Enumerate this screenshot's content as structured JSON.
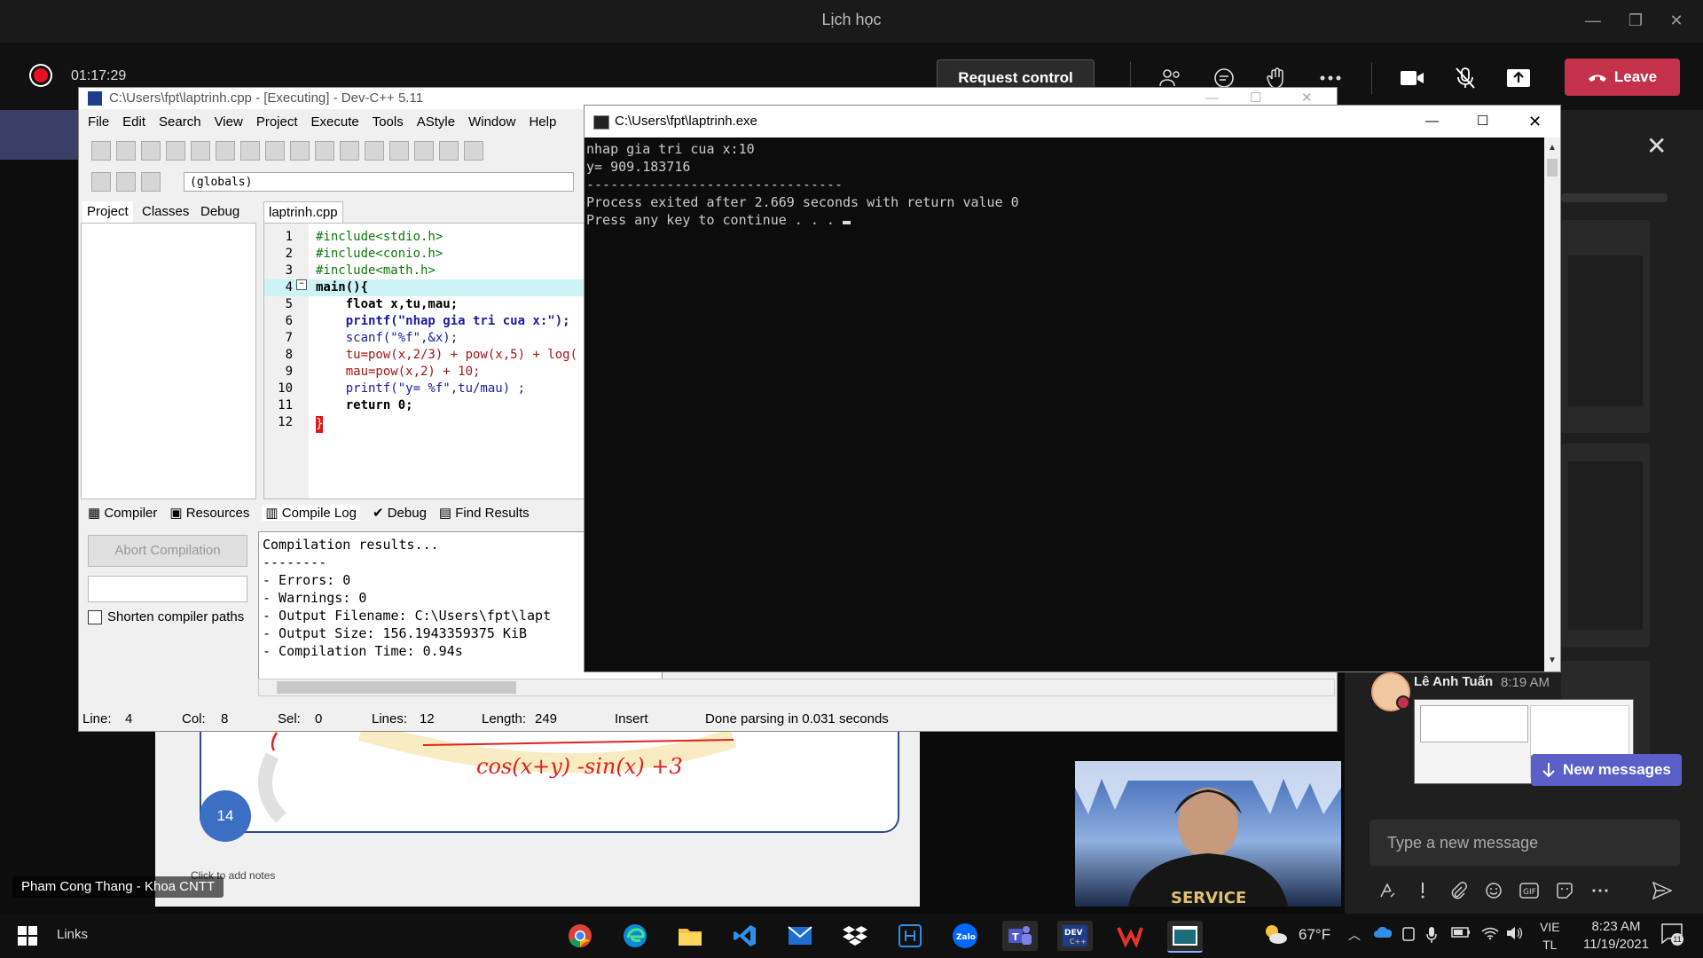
{
  "teams": {
    "window_title": "Lịch học",
    "timer": "01:17:29",
    "request_control": "Request control",
    "leave_label": "Leave",
    "presenter_name": "Pham Cong Thang - Khoa CNTT",
    "chat": {
      "author": "Lê Anh Tuấn",
      "time": "8:19 AM",
      "new_messages": "New messages",
      "compose_placeholder": "Type a new message"
    }
  },
  "ppt": {
    "slide_number": "14",
    "notes_placeholder": "Click to add notes"
  },
  "devcpp": {
    "title": "C:\\Users\\fpt\\laptrinh.cpp - [Executing] - Dev-C++ 5.11",
    "menu": [
      "File",
      "Edit",
      "Search",
      "View",
      "Project",
      "Execute",
      "Tools",
      "AStyle",
      "Window",
      "Help"
    ],
    "globals": "(globals)",
    "project_tabs": [
      "Project",
      "Classes",
      "Debug"
    ],
    "file_tab": "laptrinh.cpp",
    "code": [
      {
        "n": "1",
        "t": "#include<stdio.h>"
      },
      {
        "n": "2",
        "t": "#include<conio.h>"
      },
      {
        "n": "3",
        "t": "#include<math.h>"
      },
      {
        "n": "4",
        "t": "main(){"
      },
      {
        "n": "5",
        "t": "    float x,tu,mau;"
      },
      {
        "n": "6",
        "t": "    printf(\"nhap gia tri cua x:\");"
      },
      {
        "n": "7",
        "t": "    scanf(\"%f\",&x);"
      },
      {
        "n": "8",
        "t": "    tu=pow(x,2/3) + pow(x,5) + log("
      },
      {
        "n": "9",
        "t": "    mau=pow(x,2) + 10;"
      },
      {
        "n": "10",
        "t": "    printf(\"y= %f\",tu/mau) ;"
      },
      {
        "n": "11",
        "t": "    return 0;"
      },
      {
        "n": "12",
        "t": "}"
      }
    ],
    "bottom_tabs": [
      "Compiler",
      "Resources",
      "Compile Log",
      "Debug",
      "Find Results"
    ],
    "abort_label": "Abort Compilation",
    "shorten_label": "Shorten compiler paths",
    "log": [
      "Compilation results...",
      "--------",
      "- Errors: 0",
      "- Warnings: 0",
      "- Output Filename: C:\\Users\\fpt\\lapt",
      "- Output Size: 156.1943359375 KiB",
      "- Compilation Time: 0.94s"
    ],
    "status": {
      "line_label": "Line:",
      "line": "4",
      "col_label": "Col:",
      "col": "8",
      "sel_label": "Sel:",
      "sel": "0",
      "lines_label": "Lines:",
      "lines": "12",
      "length_label": "Length:",
      "length": "249",
      "mode": "Insert",
      "message": "Done parsing in 0.031 seconds"
    }
  },
  "console": {
    "title": "C:\\Users\\fpt\\laptrinh.exe",
    "lines": [
      "nhap gia tri cua x:10",
      "y= 909.183716",
      "--------------------------------",
      "Process exited after 2.669 seconds with return value 0",
      "Press any key to continue . . . "
    ]
  },
  "taskbar": {
    "links": "Links",
    "temperature": "67°F",
    "lang1": "VIE",
    "lang2": "TL",
    "time": "8:23 AM",
    "date": "11/19/2021",
    "notif_count": "11"
  }
}
